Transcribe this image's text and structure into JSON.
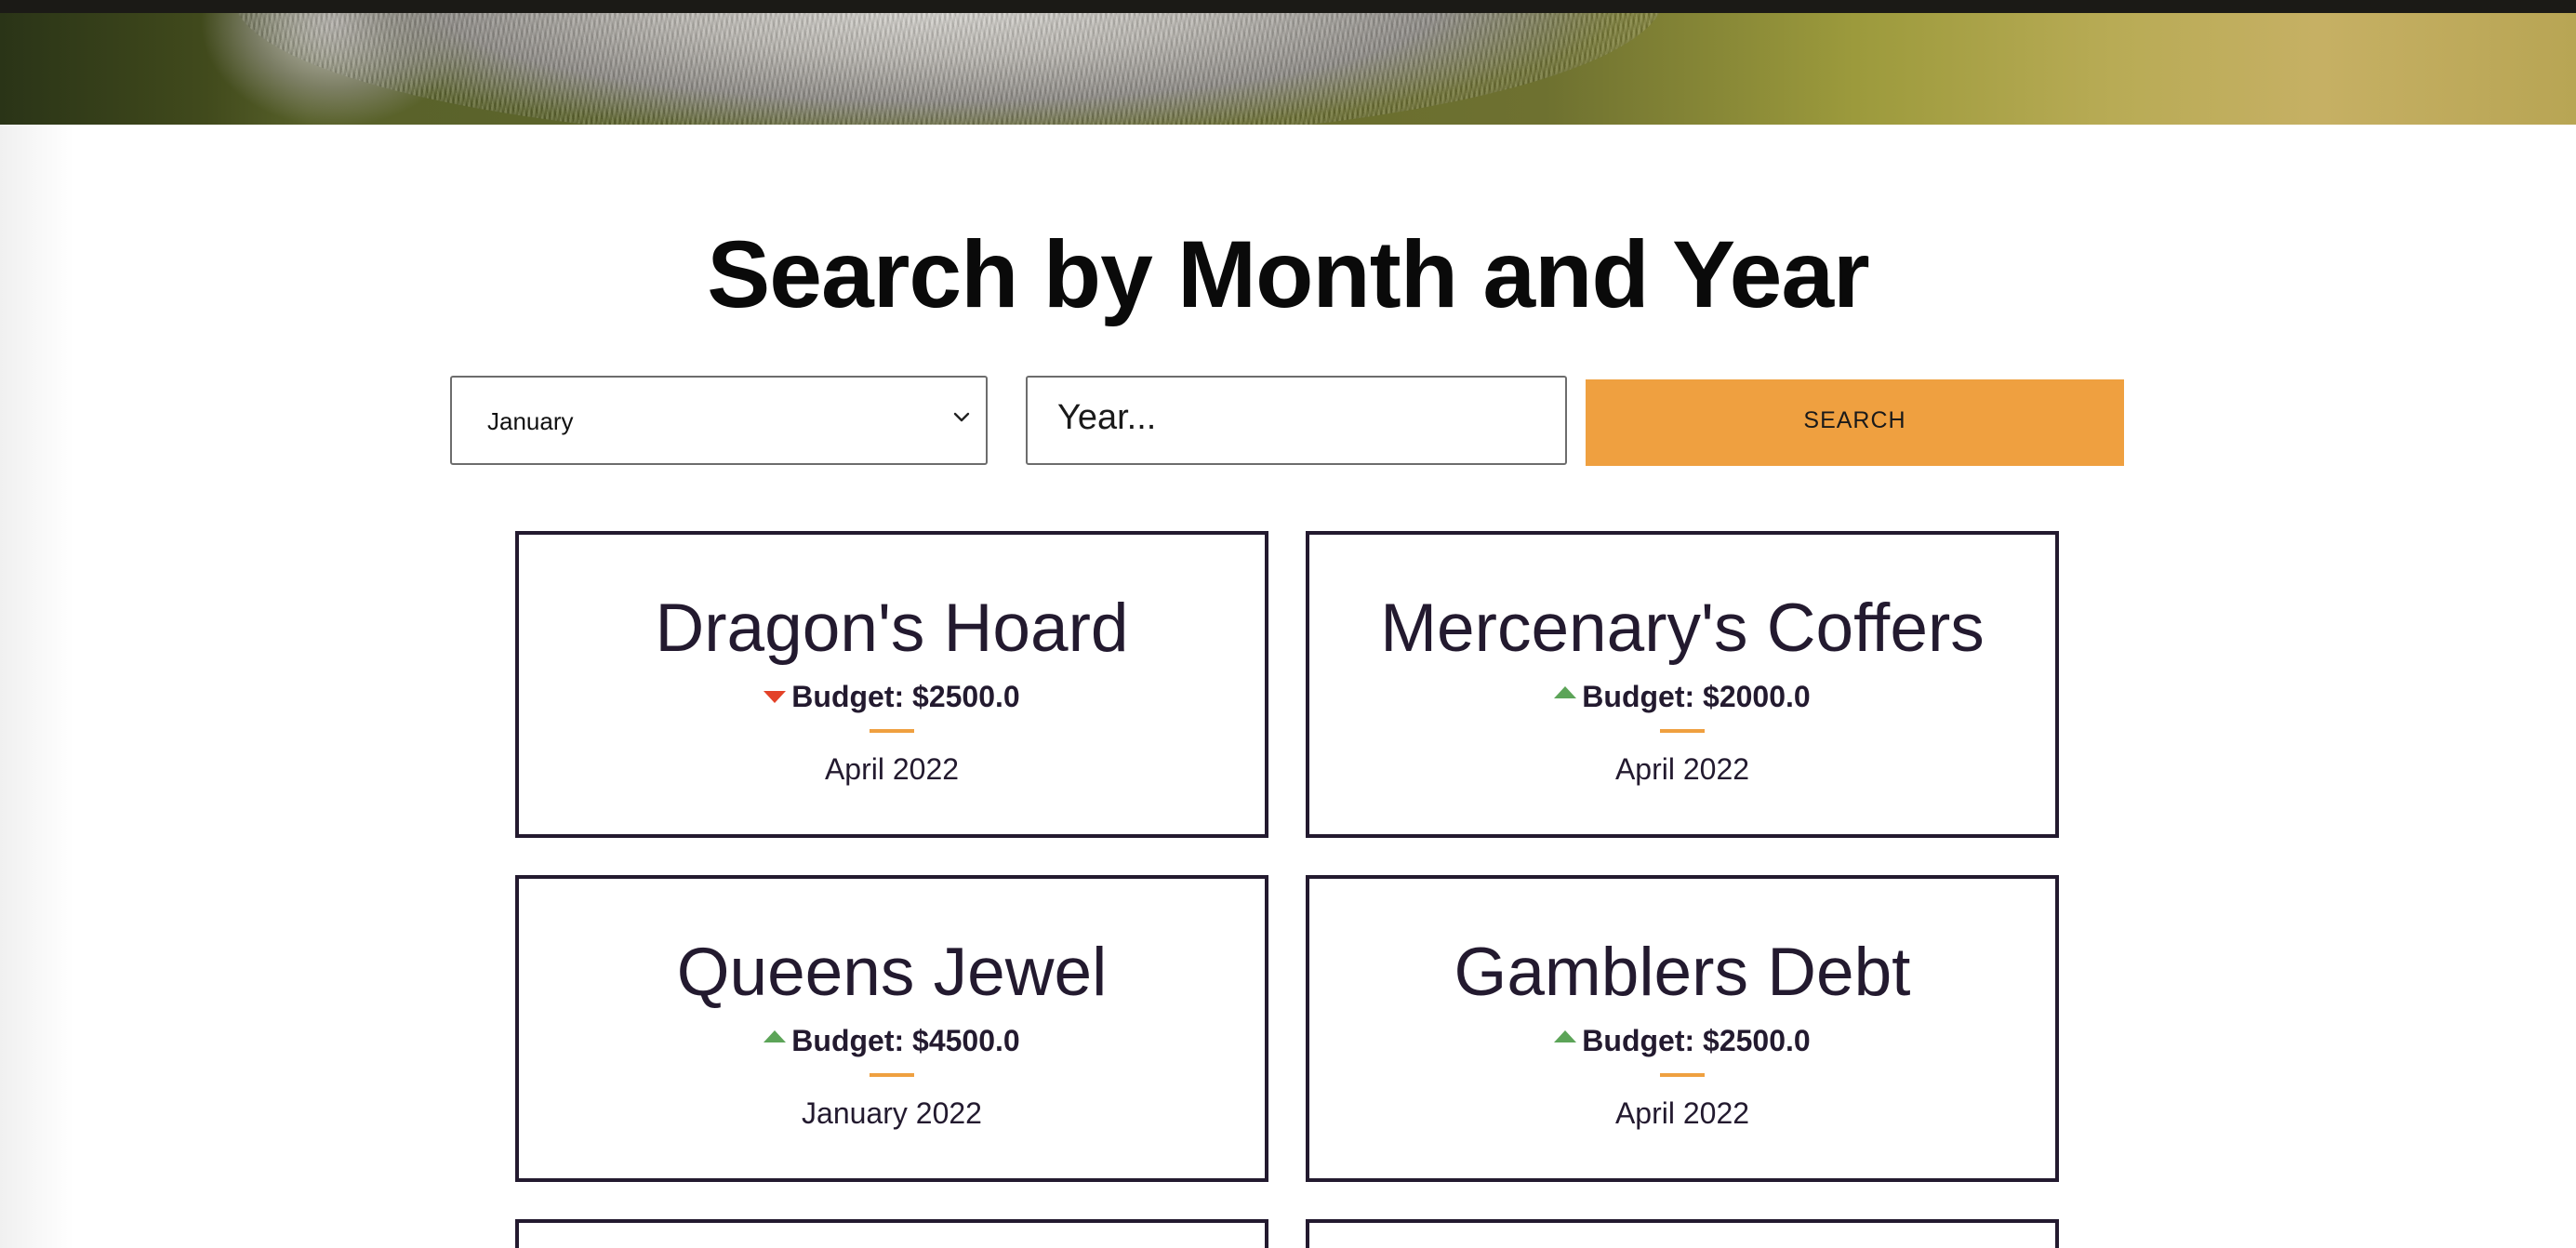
{
  "hero": {
    "image_semantic": "koala-fur-photo-banner"
  },
  "title": "Search by Month and Year",
  "search": {
    "month_selected": "January",
    "year_placeholder": "Year...",
    "button_label": "SEARCH"
  },
  "colors": {
    "accent": "#efa040",
    "text": "#231a2f",
    "down": "#e34228",
    "up": "#5ca458"
  },
  "cards": [
    {
      "name": "Dragon's Hoard",
      "trend": "down",
      "budget": "Budget: $2500.0",
      "date": "April 2022"
    },
    {
      "name": "Mercenary's Coffers",
      "trend": "up",
      "budget": "Budget: $2000.0",
      "date": "April 2022"
    },
    {
      "name": "Queens Jewel",
      "trend": "up",
      "budget": "Budget: $4500.0",
      "date": "January 2022"
    },
    {
      "name": "Gamblers Debt",
      "trend": "up",
      "budget": "Budget: $2500.0",
      "date": "April 2022"
    }
  ]
}
